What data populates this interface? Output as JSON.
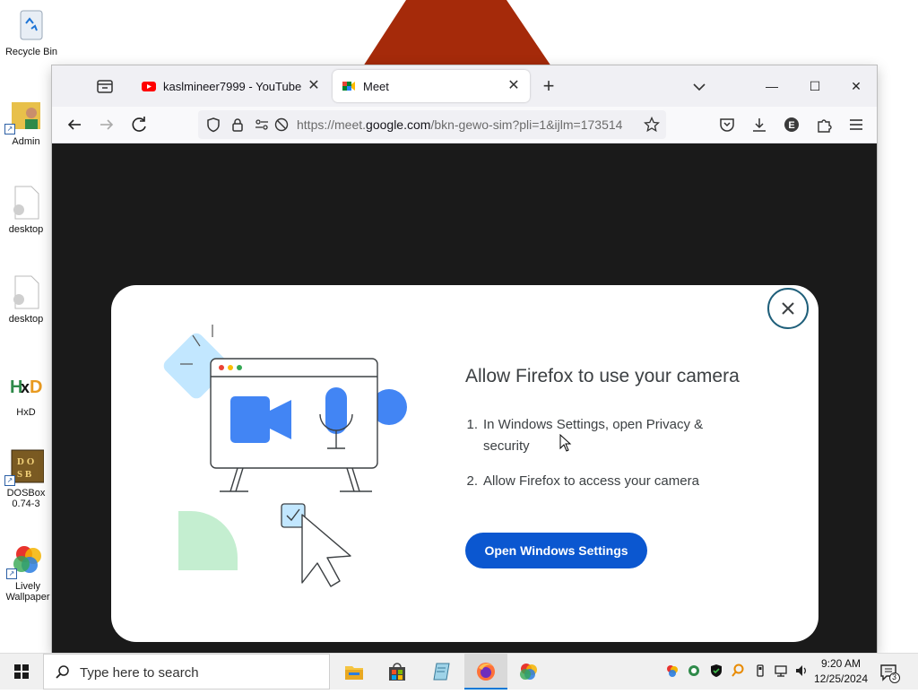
{
  "desktop": {
    "icons": [
      {
        "label": "Recycle Bin",
        "icon": "recycle-bin-icon"
      },
      {
        "label": "Admin",
        "icon": "user-folder-icon"
      },
      {
        "label": "desktop",
        "icon": "file-gear-icon"
      },
      {
        "label": "desktop",
        "icon": "file-gear-icon"
      },
      {
        "label": "HxD",
        "icon": "hxd-icon"
      },
      {
        "label": "DOSBox 0.74-3",
        "icon": "dosbox-icon"
      },
      {
        "label": "Lively Wallpaper",
        "icon": "lively-wallpaper-icon"
      }
    ]
  },
  "browser": {
    "tabs": [
      {
        "title": "kaslmineer7999 - YouTube",
        "icon": "youtube-icon",
        "active": false
      },
      {
        "title": "Meet",
        "icon": "google-meet-icon",
        "active": true
      }
    ],
    "url_prefix": "https://meet.",
    "url_domain": "google.com",
    "url_rest": "/bkn-gewo-sim?pli=1&ijlm=173514",
    "window_controls": {
      "minimize": "—",
      "maximize": "☐",
      "close": "✕"
    }
  },
  "dialog": {
    "title": "Allow Firefox to use your camera",
    "steps": [
      {
        "num": "1.",
        "text": "In Windows Settings, open Privacy & security"
      },
      {
        "num": "2.",
        "text": "Allow Firefox to access your camera"
      }
    ],
    "button_label": "Open Windows Settings"
  },
  "taskbar": {
    "search_placeholder": "Type here to search",
    "apps": [
      "file-explorer-icon",
      "microsoft-store-icon",
      "notepad-icon",
      "firefox-icon",
      "lively-wallpaper-icon"
    ],
    "clock_time": "9:20 AM",
    "clock_date": "12/25/2024",
    "notification_count": "3"
  },
  "colors": {
    "accent_button": "#0b57d0",
    "content_bg": "#1a1a1a",
    "wallpaper_shape": "#a52a0a"
  }
}
